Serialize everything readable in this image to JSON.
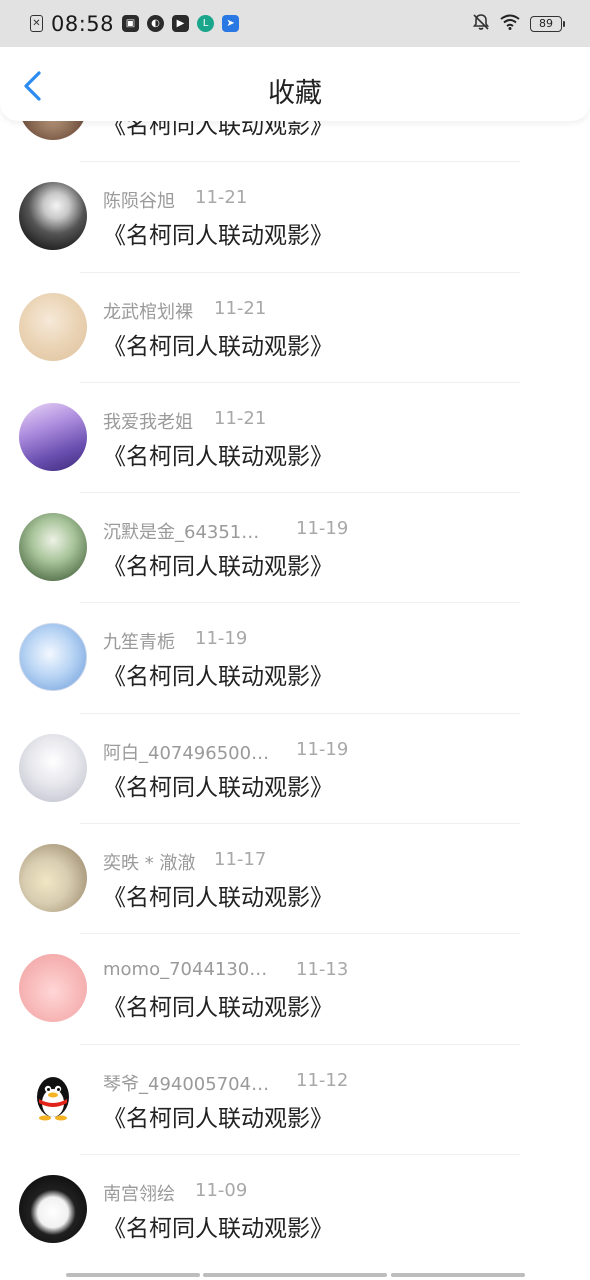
{
  "status_bar": {
    "time": "08:58",
    "battery": "89",
    "icons": [
      "sim-icon",
      "app-icon-1",
      "compass-icon",
      "play-icon",
      "teal-app-icon",
      "blue-app-icon",
      "mute-icon",
      "wifi-icon",
      "battery-icon"
    ]
  },
  "header": {
    "title": "收藏",
    "back_icon": "chevron-left-icon",
    "accent_color": "#2a8cf0"
  },
  "items": [
    {
      "user": "",
      "date": "",
      "title": "《名柯同人联动观影》"
    },
    {
      "user": "陈陨谷旭",
      "date": "11-21",
      "title": "《名柯同人联动观影》"
    },
    {
      "user": "龙武棺划裸",
      "date": "11-21",
      "title": "《名柯同人联动观影》"
    },
    {
      "user": "我爱我老姐",
      "date": "11-21",
      "title": "《名柯同人联动观影》"
    },
    {
      "user": "沉默是金_64351…",
      "date": "11-19",
      "title": "《名柯同人联动观影》"
    },
    {
      "user": "九笙青栀",
      "date": "11-19",
      "title": "《名柯同人联动观影》"
    },
    {
      "user": "阿白_407496500…",
      "date": "11-19",
      "title": "《名柯同人联动观影》"
    },
    {
      "user": "奕昳 * 澈澈",
      "date": "11-17",
      "title": "《名柯同人联动观影》"
    },
    {
      "user": "momo_7044130…",
      "date": "11-13",
      "title": "《名柯同人联动观影》"
    },
    {
      "user": "琴爷_494005704…",
      "date": "11-12",
      "title": "《名柯同人联动观影》"
    },
    {
      "user": "南宫翎绘",
      "date": "11-09",
      "title": "《名柯同人联动观影》"
    }
  ]
}
